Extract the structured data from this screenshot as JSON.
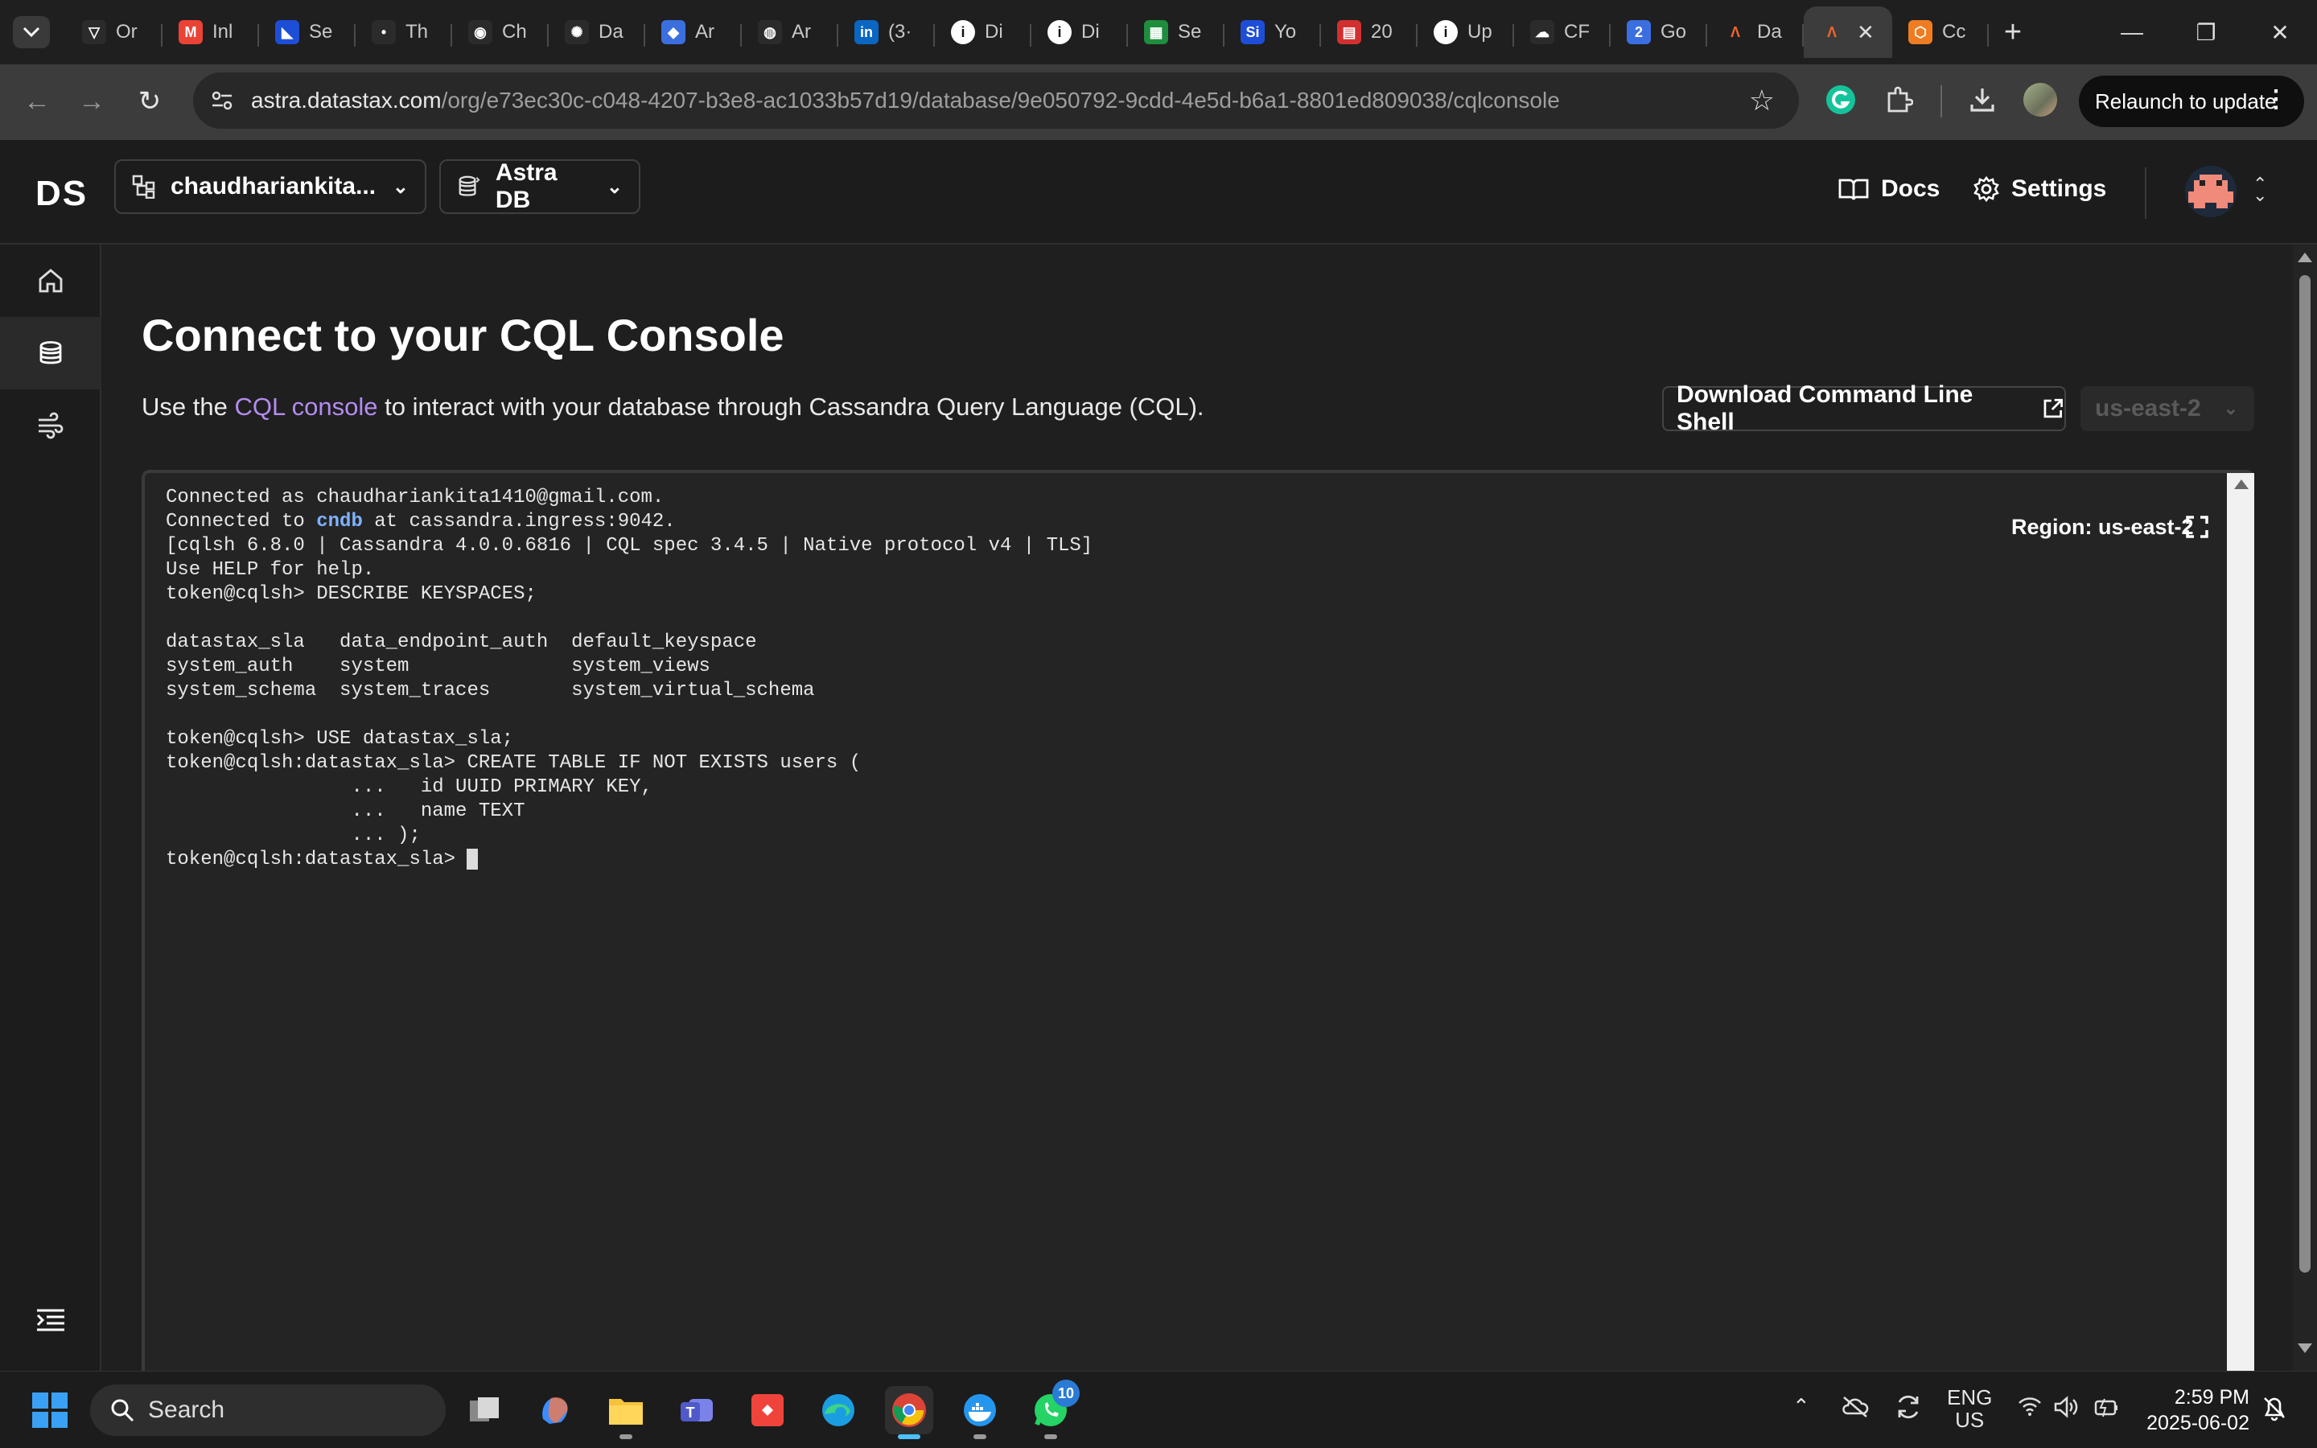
{
  "browser": {
    "tabs": [
      {
        "title": "Or",
        "icon": "vercel-icon",
        "color": "#2b2b2b"
      },
      {
        "title": "Inl",
        "icon": "gmail-icon",
        "color": "#ea4335"
      },
      {
        "title": "Se",
        "icon": "linear-icon",
        "color": "#1d4ed8"
      },
      {
        "title": "Th",
        "icon": "dot-icon",
        "color": "#2b2b2b"
      },
      {
        "title": "Ch",
        "icon": "github-icon",
        "color": "#2b2b2b"
      },
      {
        "title": "Da",
        "icon": "openai-icon",
        "color": "#2b2b2b"
      },
      {
        "title": "Ar",
        "icon": "google-docs-icon",
        "color": "#3b6fe0"
      },
      {
        "title": "Ar",
        "icon": "globe-icon",
        "color": "#2b2b2b"
      },
      {
        "title": "(3·",
        "icon": "linkedin-icon",
        "color": "#0a66c2"
      },
      {
        "title": "Di",
        "icon": "info-icon",
        "color": "#2b2b2b"
      },
      {
        "title": "Di",
        "icon": "info-icon",
        "color": "#2b2b2b"
      },
      {
        "title": "Se",
        "icon": "sheets-icon",
        "color": "#1e8e3e"
      },
      {
        "title": "Yo",
        "icon": "si-icon",
        "color": "#1d4ed8"
      },
      {
        "title": "20",
        "icon": "news-icon",
        "color": "#d23030"
      },
      {
        "title": "Up",
        "icon": "info-icon",
        "color": "#2b2b2b"
      },
      {
        "title": "CF",
        "icon": "cloud-icon",
        "color": "#2b2b2b"
      },
      {
        "title": "Go",
        "icon": "calendar-icon",
        "color": "#3b6fe0"
      },
      {
        "title": "Da",
        "icon": "astra-icon",
        "color": "#2b2b2b"
      },
      {
        "title": "",
        "icon": "astra-icon",
        "color": "#2b2b2b",
        "active": true
      },
      {
        "title": "Cc",
        "icon": "box-icon",
        "color": "#f07c22"
      }
    ],
    "url_host": "astra.datastax.com",
    "url_path": "/org/e73ec30c-c048-4207-b3e8-ac1033b57d19/database/9e050792-9cdd-4e5d-b6a1-8801ed809038/cqlconsole",
    "relaunch_label": "Relaunch to update"
  },
  "header": {
    "logo": "DS",
    "org_name": "chaudhariankita...",
    "product": "Astra DB",
    "docs_label": "Docs",
    "settings_label": "Settings"
  },
  "main": {
    "title": "Connect to your CQL Console",
    "desc_before": "Use the ",
    "desc_link": "CQL console",
    "desc_after": " to interact with your database through Cassandra Query Language (CQL).",
    "download_label": "Download Command Line Shell",
    "region_select": "us-east-2",
    "region_label": "Region: us-east-2"
  },
  "console": {
    "line1": "Connected as chaudhariankita1410@gmail.com.",
    "line2_prefix": "Connected to ",
    "line2_db": "cndb",
    "line2_suffix": " at cassandra.ingress:9042.",
    "line3": "[cqlsh 6.8.0 | Cassandra 4.0.0.6816 | CQL spec 3.4.5 | Native protocol v4 | TLS]",
    "line4": "Use HELP for help.",
    "line5": "token@cqlsh> DESCRIBE KEYSPACES;",
    "line6": "",
    "line7": "datastax_sla   data_endpoint_auth  default_keyspace",
    "line8": "system_auth    system              system_views",
    "line9": "system_schema  system_traces       system_virtual_schema",
    "line10": "",
    "line11": "token@cqlsh> USE datastax_sla;",
    "line12": "token@cqlsh:datastax_sla> CREATE TABLE IF NOT EXISTS users (",
    "line13": "                ...   id UUID PRIMARY KEY,",
    "line14": "                ...   name TEXT",
    "line15": "                ... );",
    "prompt": "token@cqlsh:datastax_sla> "
  },
  "taskbar": {
    "search_label": "Search",
    "whatsapp_badge": "10",
    "lang_line1": "ENG",
    "lang_line2": "US",
    "time": "2:59 PM",
    "date": "2025-06-02"
  }
}
